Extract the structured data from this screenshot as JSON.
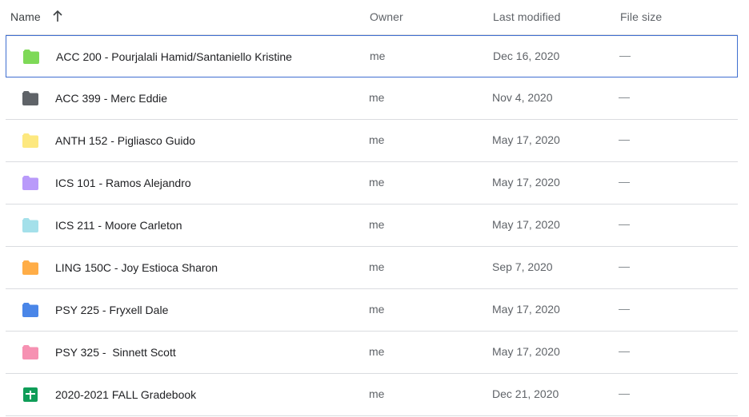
{
  "header": {
    "name": "Name",
    "owner": "Owner",
    "modified": "Last modified",
    "size": "File size"
  },
  "rows": [
    {
      "name": "ACC 200 - Pourjalali Hamid/Santaniello Kristine",
      "owner": "me",
      "modified": "Dec 16, 2020",
      "size": "—",
      "type": "folder",
      "color": "#7ed957",
      "selected": true
    },
    {
      "name": "ACC 399 - Merc Eddie",
      "owner": "me",
      "modified": "Nov 4, 2020",
      "size": "—",
      "type": "folder",
      "color": "#5f6368"
    },
    {
      "name": "ANTH 152 - Pigliasco Guido",
      "owner": "me",
      "modified": "May 17, 2020",
      "size": "—",
      "type": "folder",
      "color": "#fde87f"
    },
    {
      "name": "ICS 101 - Ramos Alejandro",
      "owner": "me",
      "modified": "May 17, 2020",
      "size": "—",
      "type": "folder",
      "color": "#b99afa"
    },
    {
      "name": "ICS 211 - Moore Carleton",
      "owner": "me",
      "modified": "May 17, 2020",
      "size": "—",
      "type": "folder",
      "color": "#a4e0ea"
    },
    {
      "name": "LING 150C - Joy Estioca Sharon",
      "owner": "me",
      "modified": "Sep 7, 2020",
      "size": "—",
      "type": "folder",
      "color": "#ffad47"
    },
    {
      "name": "PSY 225 - Fryxell Dale",
      "owner": "me",
      "modified": "May 17, 2020",
      "size": "—",
      "type": "folder",
      "color": "#4a86e8"
    },
    {
      "name": "PSY 325 -  Sinnett Scott",
      "owner": "me",
      "modified": "May 17, 2020",
      "size": "—",
      "type": "folder",
      "color": "#f691b2"
    },
    {
      "name": "2020-2021 FALL Gradebook",
      "owner": "me",
      "modified": "Dec 21, 2020",
      "size": "—",
      "type": "sheet",
      "color": "#0f9d58"
    }
  ]
}
